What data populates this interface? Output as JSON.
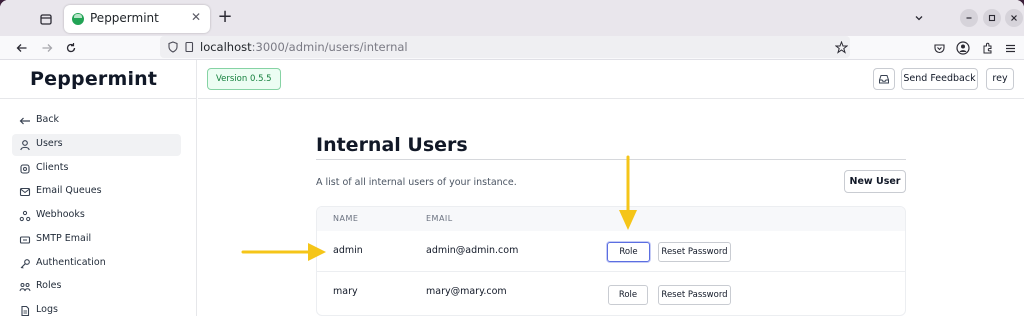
{
  "browser": {
    "tab_title": "Peppermint",
    "url_host": "localhost",
    "url_path": ":3000/admin/users/internal"
  },
  "app": {
    "brand": "Peppermint",
    "version": "Version 0.5.5",
    "send_feedback": "Send Feedback",
    "user_initial": "rey"
  },
  "sidebar": {
    "items": [
      {
        "label": "Back",
        "icon": "arrow-left-icon"
      },
      {
        "label": "Users",
        "icon": "user-icon",
        "active": true
      },
      {
        "label": "Clients",
        "icon": "clients-icon"
      },
      {
        "label": "Email Queues",
        "icon": "mail-icon"
      },
      {
        "label": "Webhooks",
        "icon": "webhook-icon"
      },
      {
        "label": "SMTP Email",
        "icon": "smtp-icon"
      },
      {
        "label": "Authentication",
        "icon": "key-icon"
      },
      {
        "label": "Roles",
        "icon": "roles-icon"
      },
      {
        "label": "Logs",
        "icon": "document-icon"
      }
    ]
  },
  "main": {
    "title": "Internal Users",
    "description": "A list of all internal users of your instance.",
    "new_user": "New User",
    "columns": [
      "NAME",
      "EMAIL"
    ],
    "users": [
      {
        "name": "admin",
        "email": "admin@admin.com",
        "role_label": "Role",
        "reset_label": "Reset Password"
      },
      {
        "name": "mary",
        "email": "mary@mary.com",
        "role_label": "Role",
        "reset_label": "Reset Password"
      }
    ]
  },
  "colors": {
    "annotation_arrow": "#f5c518",
    "focus_ring": "#5b6ee1",
    "version_badge": "#15803d"
  }
}
